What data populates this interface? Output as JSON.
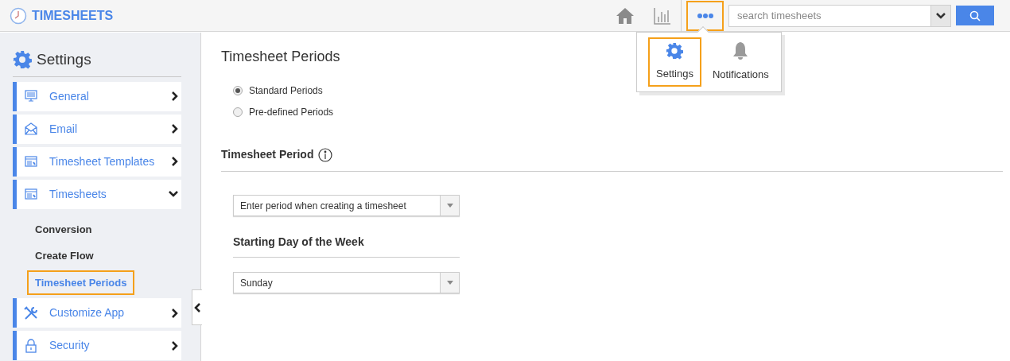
{
  "app": {
    "title": "TIMESHEETS"
  },
  "nav": [
    {
      "kind": "home",
      "selected": false
    },
    {
      "kind": "chart",
      "selected": false
    },
    {
      "kind": "more",
      "selected": true
    }
  ],
  "search": {
    "placeholder": "search timesheets"
  },
  "popup_menu": [
    {
      "kind": "gear",
      "label": "Settings",
      "selected": true
    },
    {
      "kind": "bell",
      "label": "Notifications",
      "selected": false
    }
  ],
  "sidebar": {
    "title": "Settings",
    "items": [
      {
        "kind": "monitor",
        "label": "General",
        "expanded": false
      },
      {
        "kind": "envelope",
        "label": "Email",
        "expanded": false
      },
      {
        "kind": "template",
        "label": "Timesheet Templates",
        "expanded": false
      },
      {
        "kind": "template",
        "label": "Timesheets",
        "expanded": true,
        "children": [
          {
            "label": "Conversion",
            "selected": false
          },
          {
            "label": "Create Flow",
            "selected": false
          },
          {
            "label": "Timesheet Periods",
            "selected": true
          }
        ]
      },
      {
        "kind": "tools",
        "label": "Customize App",
        "expanded": false
      },
      {
        "kind": "lock",
        "label": "Security",
        "expanded": false
      }
    ]
  },
  "content": {
    "title": "Timesheet Periods",
    "period_type": [
      {
        "label": "Standard Periods",
        "selected": true
      },
      {
        "label": "Pre-defined Periods",
        "selected": false
      }
    ],
    "section_title": "Timesheet Period",
    "period_select": "Enter period when creating a timesheet",
    "start_day_title": "Starting Day of the Week",
    "start_day_select": "Sunday"
  }
}
